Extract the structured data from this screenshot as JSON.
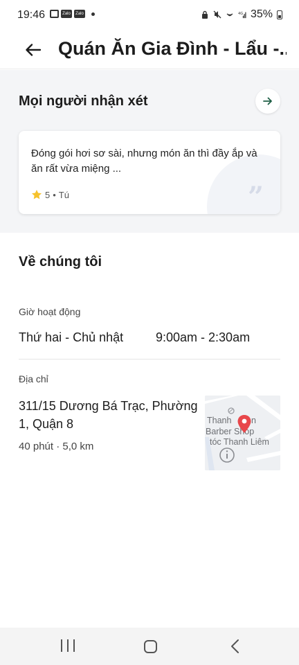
{
  "status_bar": {
    "time": "19:46",
    "zalo_badge_1": "Zalo",
    "zalo_badge_2": "Zalo",
    "battery": "35%"
  },
  "header": {
    "title": "Quán Ăn Gia Đình - Lẩu -..."
  },
  "reviews": {
    "title": "Mọi người nhận xét",
    "card": {
      "text": "Đóng gói hơi sơ sài, nhưng món ăn thì đầy ắp và ăn rất vừa miệng ...",
      "rating": "5",
      "separator": "•",
      "author": "Tú"
    }
  },
  "about": {
    "title": "Về chúng tôi",
    "hours_label": "Giờ hoạt động",
    "hours_days": "Thứ hai - Chủ nhật",
    "hours_time": "9:00am - 2:30am",
    "address_label": "Địa chỉ",
    "address": "311/15 Dương Bá Trạc, Phường 1, Quận 8",
    "distance": "40 phút · 5,0 km",
    "map": {
      "line1": "Thanh",
      "line1b": "n",
      "line2": "Barber Shop",
      "line3": "tóc Thanh Liêm"
    }
  },
  "colors": {
    "section_bg": "#f4f5f7",
    "pin": "#e8474b",
    "star": "#f6c22c",
    "arrow": "#1e5f46"
  }
}
